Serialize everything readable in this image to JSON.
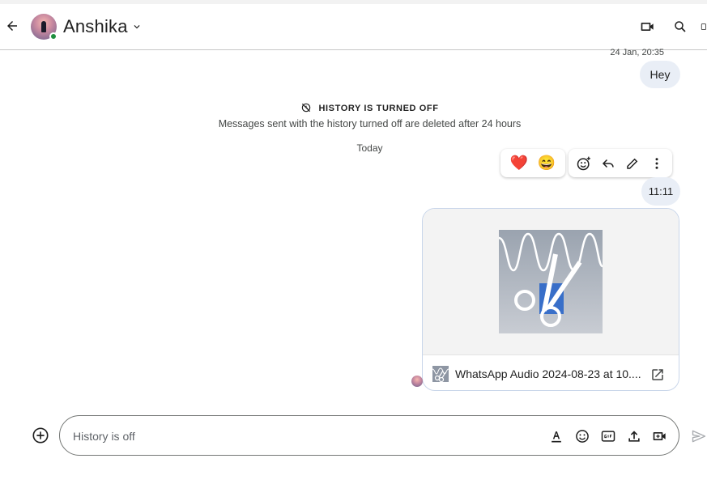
{
  "header": {
    "contact_name": "Anshika",
    "icons": [
      "back-arrow-icon",
      "chevron-down-icon",
      "video-call-icon",
      "search-icon"
    ]
  },
  "messages": {
    "timestamp": "24 Jan, 20:35",
    "hey_text": "Hey",
    "history_title": "HISTORY IS TURNED OFF",
    "history_sub": "Messages sent with the history turned off are deleted after 24 hours",
    "date_divider": "Today",
    "time_bubble": "11:11",
    "reactions": [
      "❤️",
      "😄"
    ],
    "attachment": {
      "filename": "WhatsApp Audio 2024-08-23 at 10...."
    }
  },
  "composer": {
    "placeholder": "History is off"
  },
  "colors": {
    "outgoing_bubble": "#e9eef6",
    "online_dot": "#1e8e3e",
    "attachment_border": "#c9d6ea"
  }
}
